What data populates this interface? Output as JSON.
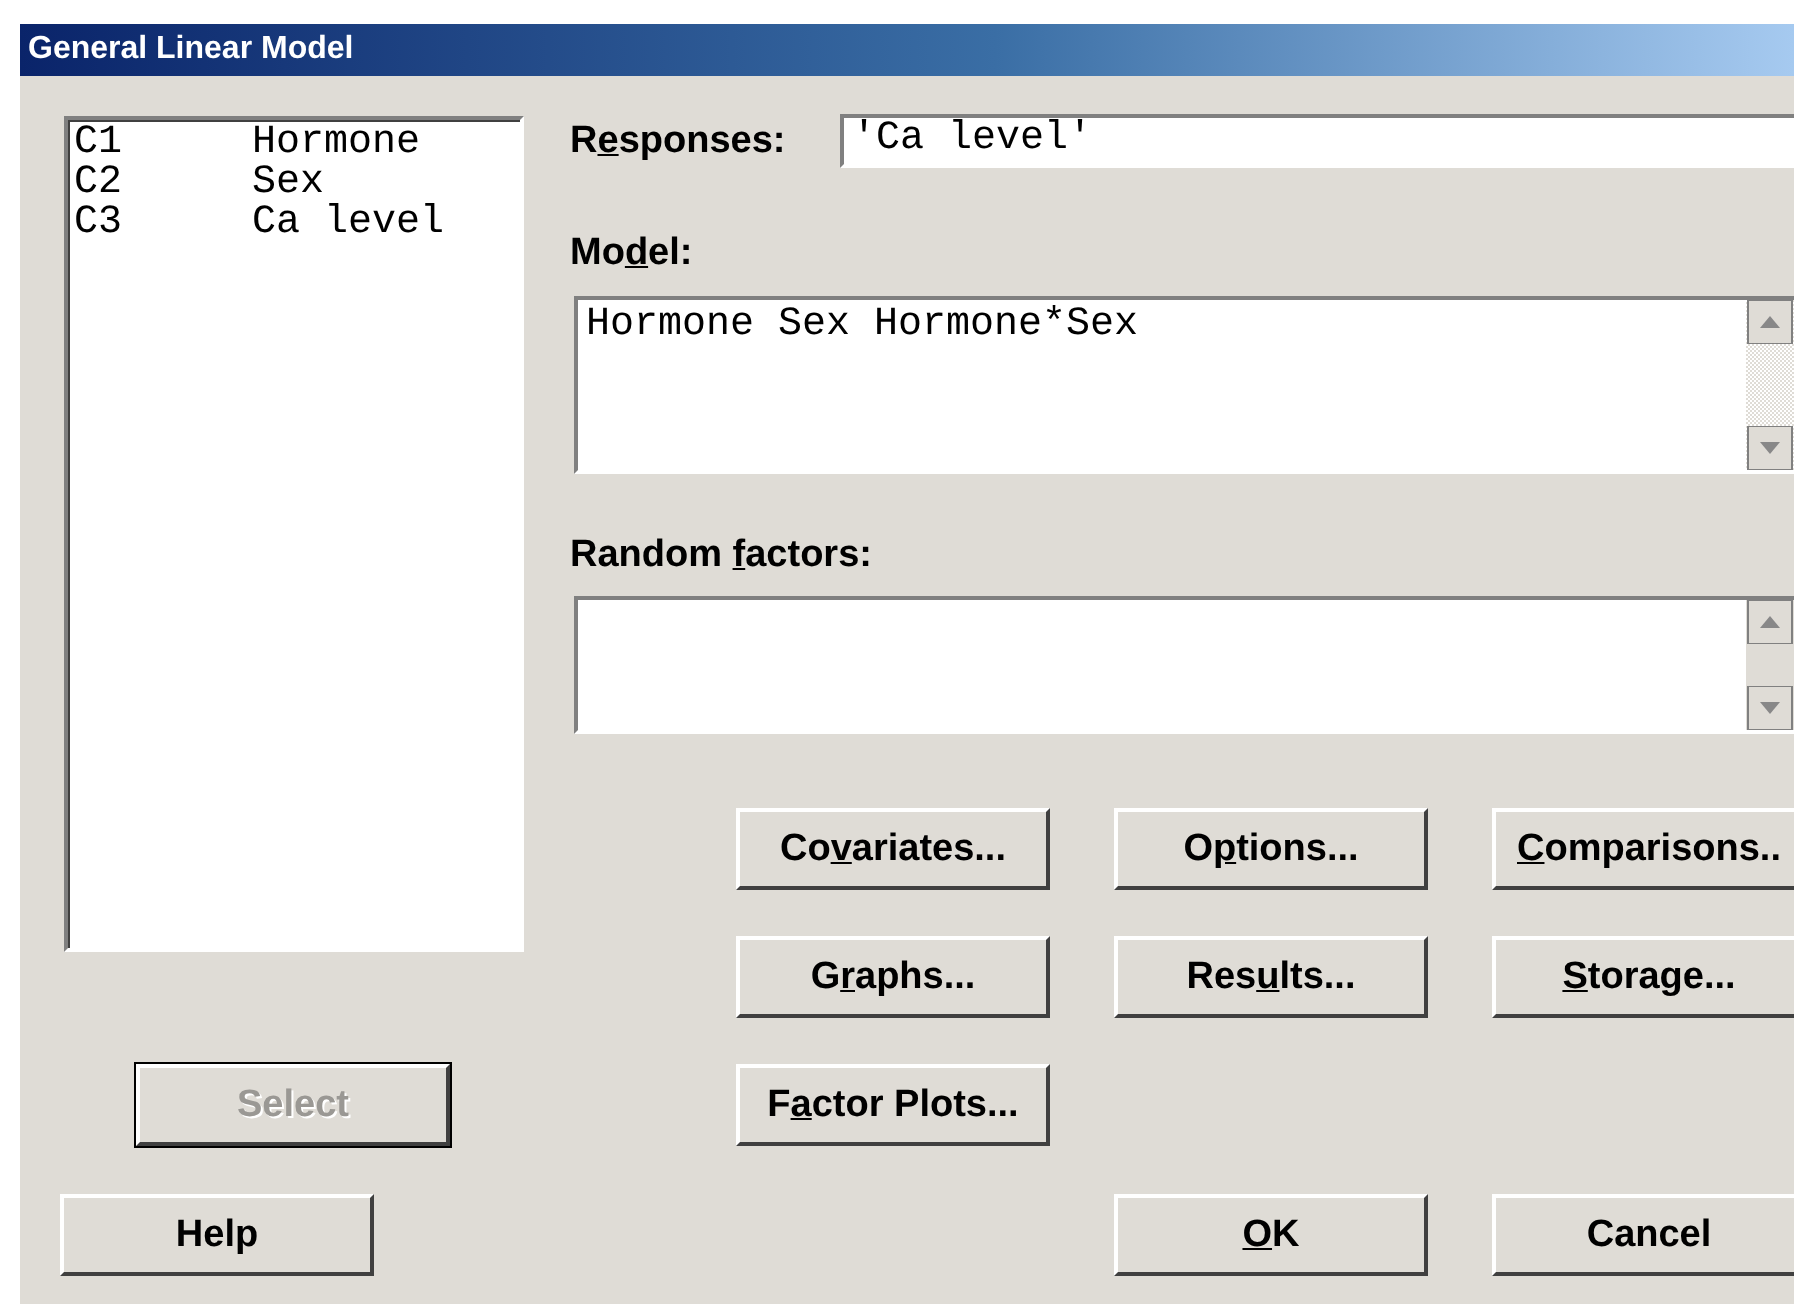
{
  "window": {
    "title": "General Linear Model"
  },
  "variables": [
    {
      "column": "C1",
      "name": "Hormone"
    },
    {
      "column": "C2",
      "name": "Sex"
    },
    {
      "column": "C3",
      "name": "Ca level"
    }
  ],
  "select_button": {
    "label": [
      {
        "text": "Select",
        "underline": false
      }
    ],
    "disabled": true
  },
  "help_button": {
    "label": [
      {
        "text": "Help",
        "underline": false
      }
    ]
  },
  "responses": {
    "label": [
      {
        "text": "R",
        "underline": false
      },
      {
        "text": "e",
        "underline": true
      },
      {
        "text": "sponses:",
        "underline": false
      }
    ],
    "value": "'Ca level'"
  },
  "model": {
    "label": [
      {
        "text": "Mo",
        "underline": false
      },
      {
        "text": "d",
        "underline": true
      },
      {
        "text": "el:",
        "underline": false
      }
    ],
    "value": "Hormone Sex Hormone*Sex"
  },
  "random_factors": {
    "label": [
      {
        "text": "Random ",
        "underline": false
      },
      {
        "text": "f",
        "underline": true
      },
      {
        "text": "actors:",
        "underline": false
      }
    ]
  },
  "button_rows": [
    {
      "buttons": [
        {
          "label": [
            {
              "text": "Co",
              "underline": false
            },
            {
              "text": "v",
              "underline": true
            },
            {
              "text": "ariates...",
              "underline": false
            }
          ]
        },
        {
          "label": [
            {
              "text": "O",
              "underline": false
            },
            {
              "text": "p",
              "underline": true
            },
            {
              "text": "tions...",
              "underline": false
            }
          ]
        },
        {
          "label": [
            {
              "text": "C",
              "underline": true
            },
            {
              "text": "omparisons..",
              "underline": false
            }
          ]
        }
      ]
    },
    {
      "buttons": [
        {
          "label": [
            {
              "text": "G",
              "underline": false
            },
            {
              "text": "r",
              "underline": true
            },
            {
              "text": "aphs...",
              "underline": false
            }
          ]
        },
        {
          "label": [
            {
              "text": "Res",
              "underline": false
            },
            {
              "text": "u",
              "underline": true
            },
            {
              "text": "lts...",
              "underline": false
            }
          ]
        },
        {
          "label": [
            {
              "text": "S",
              "underline": true
            },
            {
              "text": "torage...",
              "underline": false
            }
          ]
        }
      ]
    },
    {
      "buttons": [
        {
          "label": [
            {
              "text": "F",
              "underline": false
            },
            {
              "text": "a",
              "underline": true
            },
            {
              "text": "ctor Plots...",
              "underline": false
            }
          ]
        }
      ]
    }
  ],
  "footer_buttons": [
    {
      "label": [
        {
          "text": "O",
          "underline": true
        },
        {
          "text": "K",
          "underline": false
        }
      ]
    },
    {
      "label": [
        {
          "text": "Cancel",
          "underline": false
        }
      ]
    }
  ]
}
